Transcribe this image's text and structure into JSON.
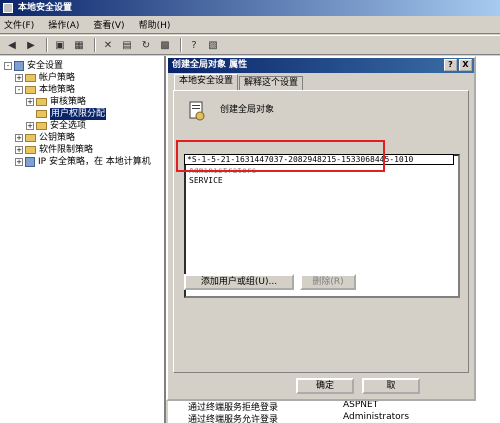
{
  "window": {
    "title": "本地安全设置"
  },
  "menu": [
    "文件(F)",
    "操作(A)",
    "查看(V)",
    "帮助(H)"
  ],
  "tree": [
    {
      "label": "安全设置",
      "indent": 0,
      "exp": "-",
      "icon": "shield"
    },
    {
      "label": "帐户策略",
      "indent": 1,
      "exp": "+",
      "icon": "folder"
    },
    {
      "label": "本地策略",
      "indent": 1,
      "exp": "-",
      "icon": "folder"
    },
    {
      "label": "审核策略",
      "indent": 2,
      "exp": "+",
      "icon": "folder"
    },
    {
      "label": "用户权限分配",
      "indent": 2,
      "exp": "",
      "icon": "folder",
      "selected": true
    },
    {
      "label": "安全选项",
      "indent": 2,
      "exp": "+",
      "icon": "folder"
    },
    {
      "label": "公钥策略",
      "indent": 1,
      "exp": "+",
      "icon": "folder"
    },
    {
      "label": "软件限制策略",
      "indent": 1,
      "exp": "+",
      "icon": "folder"
    },
    {
      "label": "IP 安全策略，在 本地计算机",
      "indent": 1,
      "exp": "+",
      "icon": "shield"
    }
  ],
  "background_rows": [
    {
      "policy": "通过终端服务拒绝登录",
      "setting": "ASPNET"
    },
    {
      "policy": "通过终端服务允许登录",
      "setting": "Administrators"
    }
  ],
  "dialog": {
    "title": "创建全局对象 属性",
    "help_btn": "?",
    "close_btn": "X",
    "tabs": [
      "本地安全设置",
      "解释这个设置"
    ],
    "object_name": "创建全局对象",
    "edit_value": "*S-1-5-21-1631447037-2082948215-1533068445-1010",
    "list_items": [
      "Administrators",
      "SERVICE"
    ],
    "add_button": "添加用户或组(U)...",
    "remove_button": "删除(R)",
    "ok_button": "确定",
    "cancel_button": "取"
  }
}
